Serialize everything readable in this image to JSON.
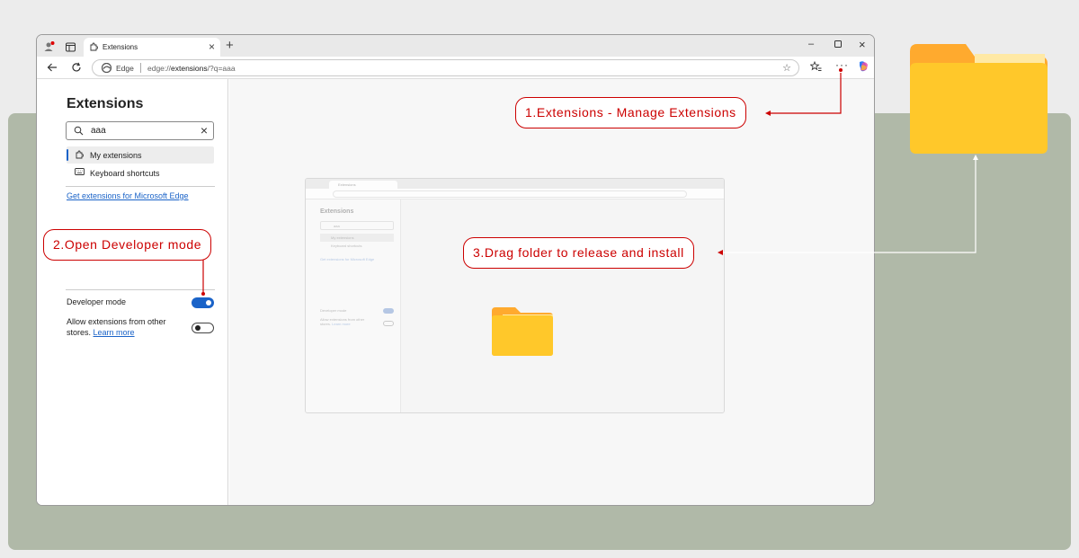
{
  "tab": {
    "title": "Extensions"
  },
  "address": {
    "engine": "Edge",
    "url_prefix": "edge://",
    "url_host": "extensions",
    "url_rest": "/?q=aaa"
  },
  "sidebar": {
    "title": "Extensions",
    "search_value": "aaa",
    "items": [
      {
        "label": "My extensions",
        "active": true
      },
      {
        "label": "Keyboard shortcuts",
        "active": false
      }
    ],
    "get_extensions": "Get extensions for Microsoft Edge",
    "developer_mode": {
      "label": "Developer mode",
      "enabled": true
    },
    "other_stores": {
      "label": "Allow extensions from other stores.",
      "learn_more": "Learn more",
      "enabled": false
    }
  },
  "ghost": {
    "tab_title": "Extensions",
    "title": "Extensions",
    "search_value": "aaa",
    "item1": "My extensions",
    "item2": "Keyboard shortcuts",
    "get_extensions": "Get extensions for Microsoft Edge",
    "developer_mode": "Developer mode",
    "other_stores": "Allow extensions from other stores.",
    "learn_more": "Learn more"
  },
  "callouts": {
    "step1": "1.Extensions - Manage Extensions",
    "step2": "2.Open Developer mode",
    "step3": "3.Drag folder to release and install"
  },
  "colors": {
    "accent": "#1a63c8",
    "callout": "#cc0000",
    "folder_front": "#ffc82a",
    "folder_back": "#ffaa2e",
    "backdrop": "#b0b9a8"
  }
}
